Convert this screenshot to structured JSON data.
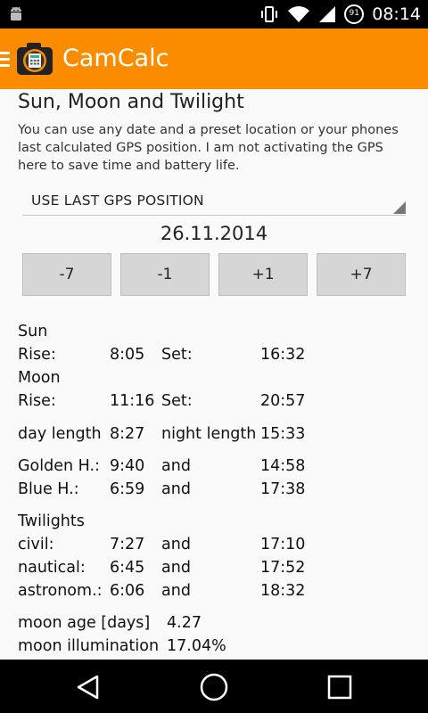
{
  "status_bar": {
    "time": "08:14",
    "battery_level": "91",
    "icons": [
      "android-icon",
      "vibrate-icon",
      "wifi-icon",
      "signal-icon",
      "battery-icon"
    ]
  },
  "app_bar": {
    "title": "CamCalc",
    "icons": [
      "menu-icon",
      "camera-calculator-icon"
    ],
    "accent_color": "#fb8c00"
  },
  "page": {
    "heading": "Sun, Moon and Twilight",
    "description": "You can use any date and a preset location or your phones last calculated GPS position. I am not activating the GPS here to save time and battery life."
  },
  "location_spinner": {
    "selected": "USE LAST GPS POSITION"
  },
  "date": "26.11.2014",
  "date_buttons": [
    "-7",
    "-1",
    "+1",
    "+7"
  ],
  "sun": {
    "label": "Sun",
    "rise_label": "Rise:",
    "rise": "8:05",
    "set_label": "Set:",
    "set": "16:32"
  },
  "moon": {
    "label": "Moon",
    "rise_label": "Rise:",
    "rise": "11:16",
    "set_label": "Set:",
    "set": "20:57"
  },
  "day_length": {
    "label": "day length",
    "value": "8:27",
    "night_label": "night length",
    "night_value": "15:33"
  },
  "golden_hour": {
    "label": "Golden H.:",
    "start": "9:40",
    "and": "and",
    "end": "14:58"
  },
  "blue_hour": {
    "label": "Blue H.:",
    "start": "6:59",
    "and": "and",
    "end": "17:38"
  },
  "twilights": {
    "label": "Twilights",
    "rows": [
      {
        "label": "civil:",
        "start": "7:27",
        "and": "and",
        "end": "17:10"
      },
      {
        "label": "nautical:",
        "start": "6:45",
        "and": "and",
        "end": "17:52"
      },
      {
        "label": "astronom.:",
        "start": "6:06",
        "and": "and",
        "end": "18:32"
      }
    ]
  },
  "moon_age": {
    "label": "moon age [days]",
    "value": "4.27"
  },
  "moon_illumination": {
    "label": "moon illumination",
    "value": "17.04%"
  },
  "nav_bar": {
    "icons": [
      "back-icon",
      "home-icon",
      "recents-icon"
    ]
  }
}
